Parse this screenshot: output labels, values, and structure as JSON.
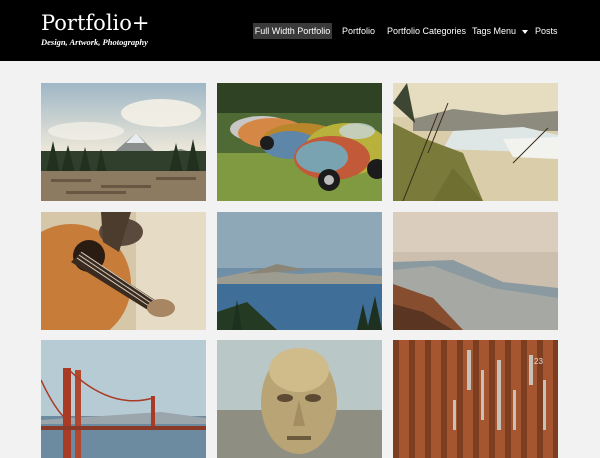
{
  "site": {
    "title": "Portfolio+",
    "tagline": "Design, Artwork, Photography"
  },
  "nav": {
    "items": [
      {
        "label": "Full Width Portfolio",
        "active": true
      },
      {
        "label": "Portfolio"
      },
      {
        "label": "Portfolio Categories"
      },
      {
        "label": "Tags Menu",
        "has_dropdown": true
      },
      {
        "label": "Posts"
      }
    ]
  },
  "colors": {
    "header_bg": "#000000",
    "page_bg": "#f2f2f2",
    "active_nav_bg": "#3a3a3a",
    "text": "#ffffff"
  },
  "portfolio": {
    "items": [
      {
        "subject": "mountain-forest"
      },
      {
        "subject": "vintage-beetles"
      },
      {
        "subject": "coastal-hills"
      },
      {
        "subject": "acoustic-guitar"
      },
      {
        "subject": "crater-lake"
      },
      {
        "subject": "misty-shoreline"
      },
      {
        "subject": "golden-gate-bridge"
      },
      {
        "subject": "giant-statue-head"
      },
      {
        "subject": "corrugated-metal"
      }
    ],
    "sign_text": "23"
  }
}
